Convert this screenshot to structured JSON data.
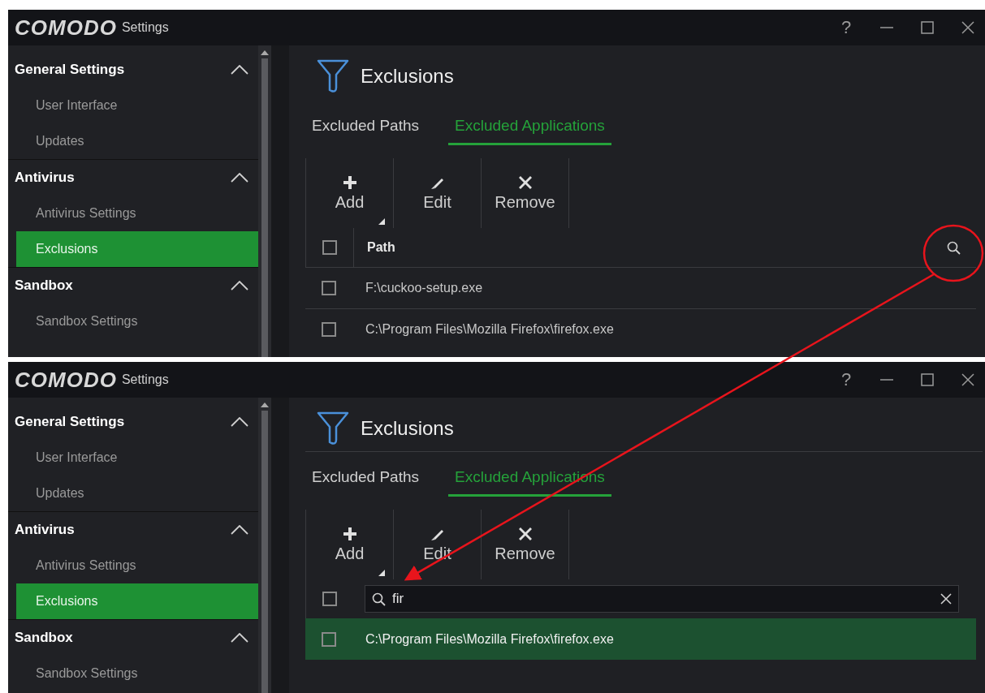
{
  "panels": [
    {
      "window": {
        "logo": "COMODO",
        "title": "Settings",
        "help": "?"
      },
      "sidebar": {
        "groups": [
          {
            "label": "General Settings",
            "expanded": true,
            "children": [
              {
                "label": "User Interface",
                "selected": false
              },
              {
                "label": "Updates",
                "selected": false
              }
            ]
          },
          {
            "label": "Antivirus",
            "expanded": true,
            "children": [
              {
                "label": "Antivirus Settings",
                "selected": false
              },
              {
                "label": "Exclusions",
                "selected": true
              }
            ]
          },
          {
            "label": "Sandbox",
            "expanded": true,
            "children": [
              {
                "label": "Sandbox Settings",
                "selected": false
              }
            ]
          }
        ]
      },
      "heading": "Exclusions",
      "tabs": [
        {
          "label": "Excluded Paths",
          "selected": false
        },
        {
          "label": "Excluded Applications",
          "selected": true
        }
      ],
      "toolbar": [
        {
          "kind": "add",
          "label": "Add"
        },
        {
          "kind": "edit",
          "label": "Edit"
        },
        {
          "kind": "remove",
          "label": "Remove"
        }
      ],
      "table": {
        "header": {
          "kind": "column",
          "label": "Path",
          "checked": false
        },
        "rows": [
          {
            "path": "F:\\cuckoo-setup.exe",
            "checked": false,
            "selected": false
          },
          {
            "path": "C:\\Program Files\\Mozilla Firefox\\firefox.exe",
            "checked": false,
            "selected": false
          }
        ]
      }
    },
    {
      "window": {
        "logo": "COMODO",
        "title": "Settings",
        "help": "?"
      },
      "sidebar": {
        "groups": [
          {
            "label": "General Settings",
            "expanded": true,
            "children": [
              {
                "label": "User Interface",
                "selected": false
              },
              {
                "label": "Updates",
                "selected": false
              }
            ]
          },
          {
            "label": "Antivirus",
            "expanded": true,
            "children": [
              {
                "label": "Antivirus Settings",
                "selected": false
              },
              {
                "label": "Exclusions",
                "selected": true
              }
            ]
          },
          {
            "label": "Sandbox",
            "expanded": true,
            "children": [
              {
                "label": "Sandbox Settings",
                "selected": false
              }
            ]
          }
        ]
      },
      "heading": "Exclusions",
      "tabs": [
        {
          "label": "Excluded Paths",
          "selected": false
        },
        {
          "label": "Excluded Applications",
          "selected": true
        }
      ],
      "toolbar": [
        {
          "kind": "add",
          "label": "Add"
        },
        {
          "kind": "edit",
          "label": "Edit"
        },
        {
          "kind": "remove",
          "label": "Remove"
        }
      ],
      "table": {
        "header": {
          "kind": "search",
          "value": "fir",
          "checked": false
        },
        "rows": [
          {
            "path": "C:\\Program Files\\Mozilla Firefox\\firefox.exe",
            "checked": false,
            "selected": true
          }
        ]
      }
    }
  ]
}
